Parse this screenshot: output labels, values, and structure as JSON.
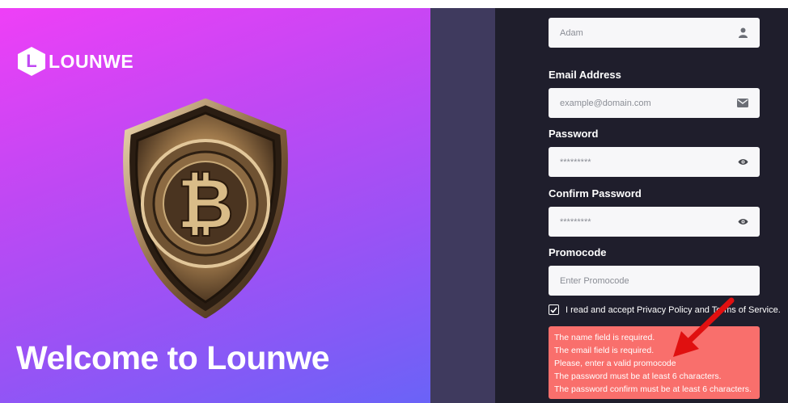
{
  "brand": {
    "logo_letter": "L",
    "name": "LOUNWE",
    "welcome": "Welcome to Lounwe"
  },
  "form": {
    "name": {
      "value": "Adam",
      "icon": "user-icon"
    },
    "email": {
      "label": "Email Address",
      "placeholder": "example@domain.com",
      "icon": "envelope-icon"
    },
    "password": {
      "label": "Password",
      "value": "*********",
      "icon": "eye-icon"
    },
    "confirm_password": {
      "label": "Confirm Password",
      "value": "*********",
      "icon": "eye-icon"
    },
    "promocode": {
      "label": "Promocode",
      "placeholder": "Enter Promocode"
    },
    "terms": {
      "checked": true,
      "text": "I read and accept Privacy Policy and Terms of Service."
    }
  },
  "errors": [
    "The name field is required.",
    "The email field is required.",
    "Please, enter a valid promocode",
    "The password must be at least 6 characters.",
    "The password confirm must be at least 6 characters."
  ],
  "colors": {
    "hero_gradient_start": "#ef3ff7",
    "hero_gradient_end": "#6a63f7",
    "form_bg": "#1f1e2c",
    "error_bg": "#f96f6c",
    "annotation_arrow": "#e01010"
  }
}
